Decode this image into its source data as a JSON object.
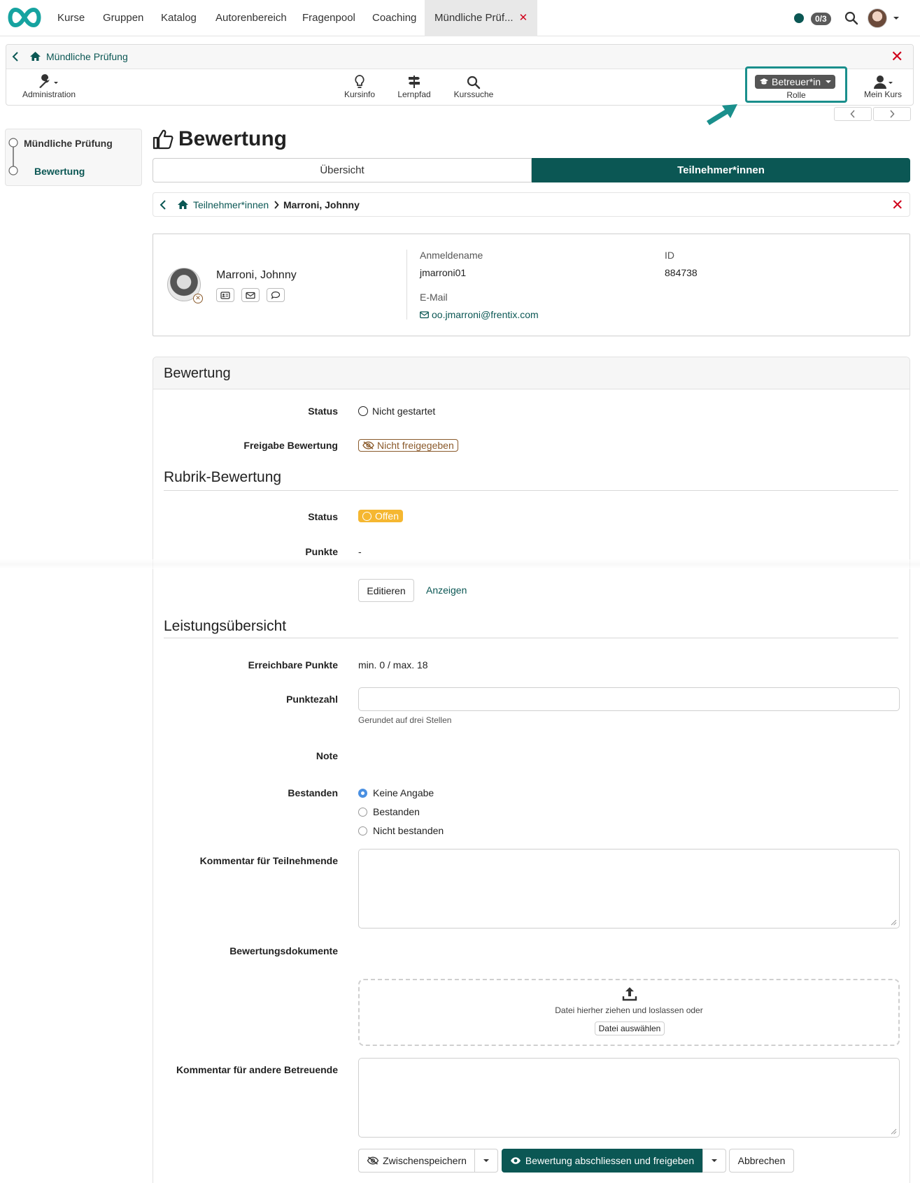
{
  "topnav": {
    "items": [
      "Kurse",
      "Gruppen",
      "Katalog",
      "Autorenbereich",
      "Fragenpool",
      "Coaching"
    ],
    "active_tab": "Mündliche Prüf...",
    "badge": "0/3",
    "colors": {
      "online": "#0b5754",
      "close": "#d0021b"
    }
  },
  "course": {
    "title": "Mündliche Prüfung",
    "tools": {
      "admin": "Administration",
      "info": "Kursinfo",
      "path": "Lernpfad",
      "search": "Kurssuche",
      "mycourse": "Mein Kurs"
    },
    "role": {
      "value": "Betreuer*in",
      "label": "Rolle"
    }
  },
  "leftmenu": {
    "items": [
      "Mündliche Prüfung",
      "Bewertung"
    ]
  },
  "page": {
    "title": "Bewertung",
    "tabs": [
      "Übersicht",
      "Teilnehmer*innen"
    ],
    "breadcrumb": {
      "parent": "Teilnehmer*innen",
      "current": "Marroni, Johnny"
    }
  },
  "user": {
    "name": "Marroni, Johnny",
    "login_label": "Anmeldename",
    "login": "jmarroni01",
    "id_label": "ID",
    "id": "884738",
    "email_label": "E-Mail",
    "email": "oo.jmarroni@frentix.com"
  },
  "form": {
    "panel_title": "Bewertung",
    "status_label": "Status",
    "status_value": "Nicht gestartet",
    "release_label": "Freigabe Bewertung",
    "release_value": "Nicht freigegeben",
    "rubric": {
      "heading": "Rubrik-Bewertung",
      "status_label": "Status",
      "status_value": "Offen",
      "points_label": "Punkte",
      "points_value": "-",
      "edit_button": "Editieren",
      "show_link": "Anzeigen"
    },
    "performance": {
      "heading": "Leistungsübersicht",
      "reachable_label": "Erreichbare Punkte",
      "reachable_value": "min. 0 / max. 18",
      "score_label": "Punktezahl",
      "score_hint": "Gerundet auf drei Stellen",
      "grade_label": "Note",
      "passed_label": "Bestanden",
      "passed_options": [
        "Keine Angabe",
        "Bestanden",
        "Nicht bestanden"
      ],
      "comment_label": "Kommentar für Teilnehmende",
      "docs_label": "Bewertungsdokumente",
      "drop_text": "Datei hierher ziehen und loslassen oder",
      "choose_file": "Datei auswählen",
      "coach_comment_label": "Kommentar für andere Betreuende"
    },
    "buttons": {
      "save": "Zwischenspeichern",
      "finish": "Bewertung abschliessen und freigeben",
      "cancel": "Abbrechen"
    }
  }
}
